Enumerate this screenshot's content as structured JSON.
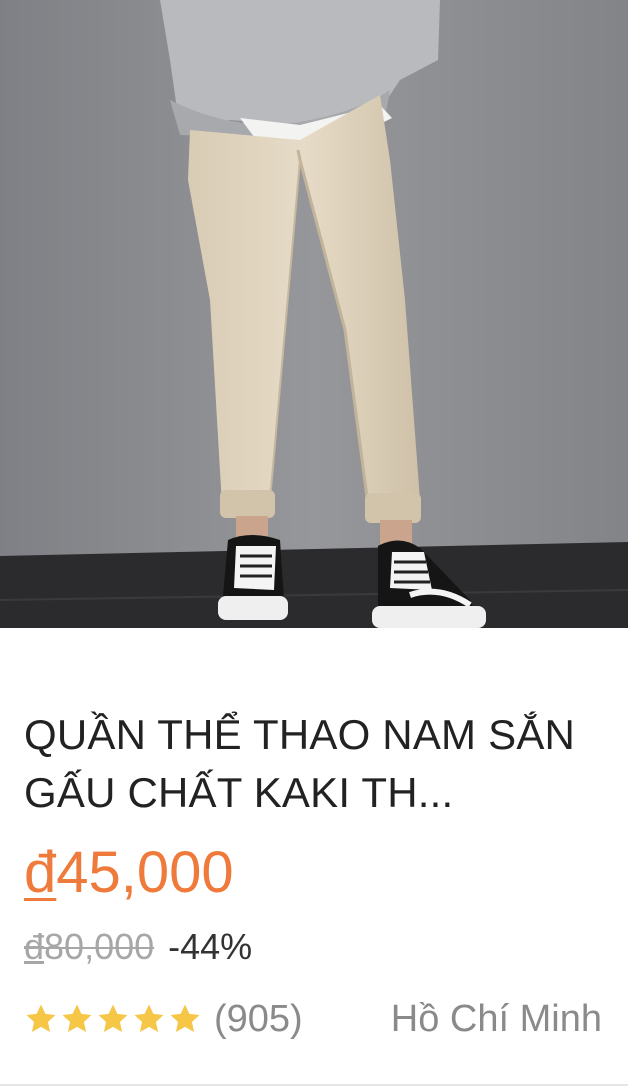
{
  "product": {
    "image_alt": "khaki pants with black sneakers",
    "title": "QUẦN THỂ THAO NAM SẮN GẤU CHẤT KAKI TH...",
    "price_currency": "đ",
    "price_amount": "45,000",
    "original_currency": "đ",
    "original_amount": "80,000",
    "discount": "-44%",
    "rating": 5,
    "review_count": "(905)",
    "location": "Hồ Chí Minh"
  },
  "colors": {
    "price": "#ee7a3b",
    "star": "#f6c646",
    "muted": "#8a8a8a"
  }
}
